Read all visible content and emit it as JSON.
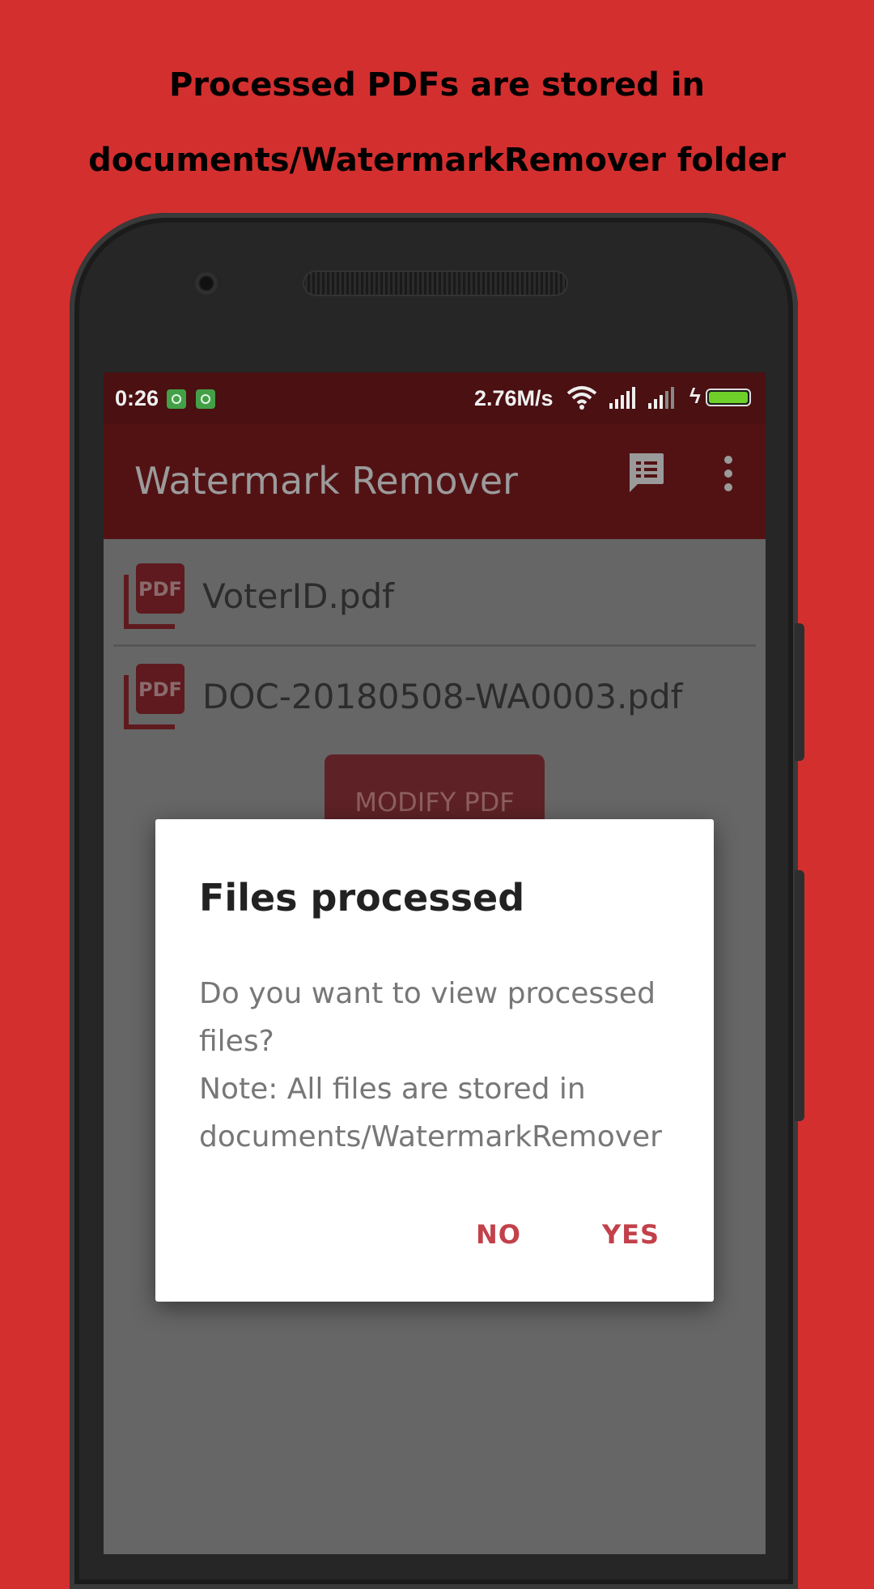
{
  "promo": {
    "line1": "Processed PDFs are stored in",
    "line2": "documents/WatermarkRemover folder"
  },
  "status_bar": {
    "time": "0:26",
    "network_speed": "2.76M/s",
    "notification_icons": [
      "app-notification-icon",
      "app-notification-icon"
    ],
    "battery_color": "#6fd02a"
  },
  "app_bar": {
    "title": "Watermark Remover",
    "actions": [
      "feedback-icon",
      "more-vert-icon"
    ]
  },
  "files": [
    {
      "name": "VoterID.pdf",
      "icon": "pdf-icon"
    },
    {
      "name": "DOC-20180508-WA0003.pdf",
      "icon": "pdf-icon"
    }
  ],
  "modify_button": {
    "label": "MODIFY PDF"
  },
  "dialog": {
    "title": "Files processed",
    "message_lines": [
      "Do you want to view processed",
      "files?",
      "Note: All files are stored in",
      "documents/WatermarkRemover"
    ],
    "no_label": "NO",
    "yes_label": "YES"
  },
  "colors": {
    "background": "#d32f2f",
    "app_bar": "#521214",
    "accent": "#c2414a"
  }
}
